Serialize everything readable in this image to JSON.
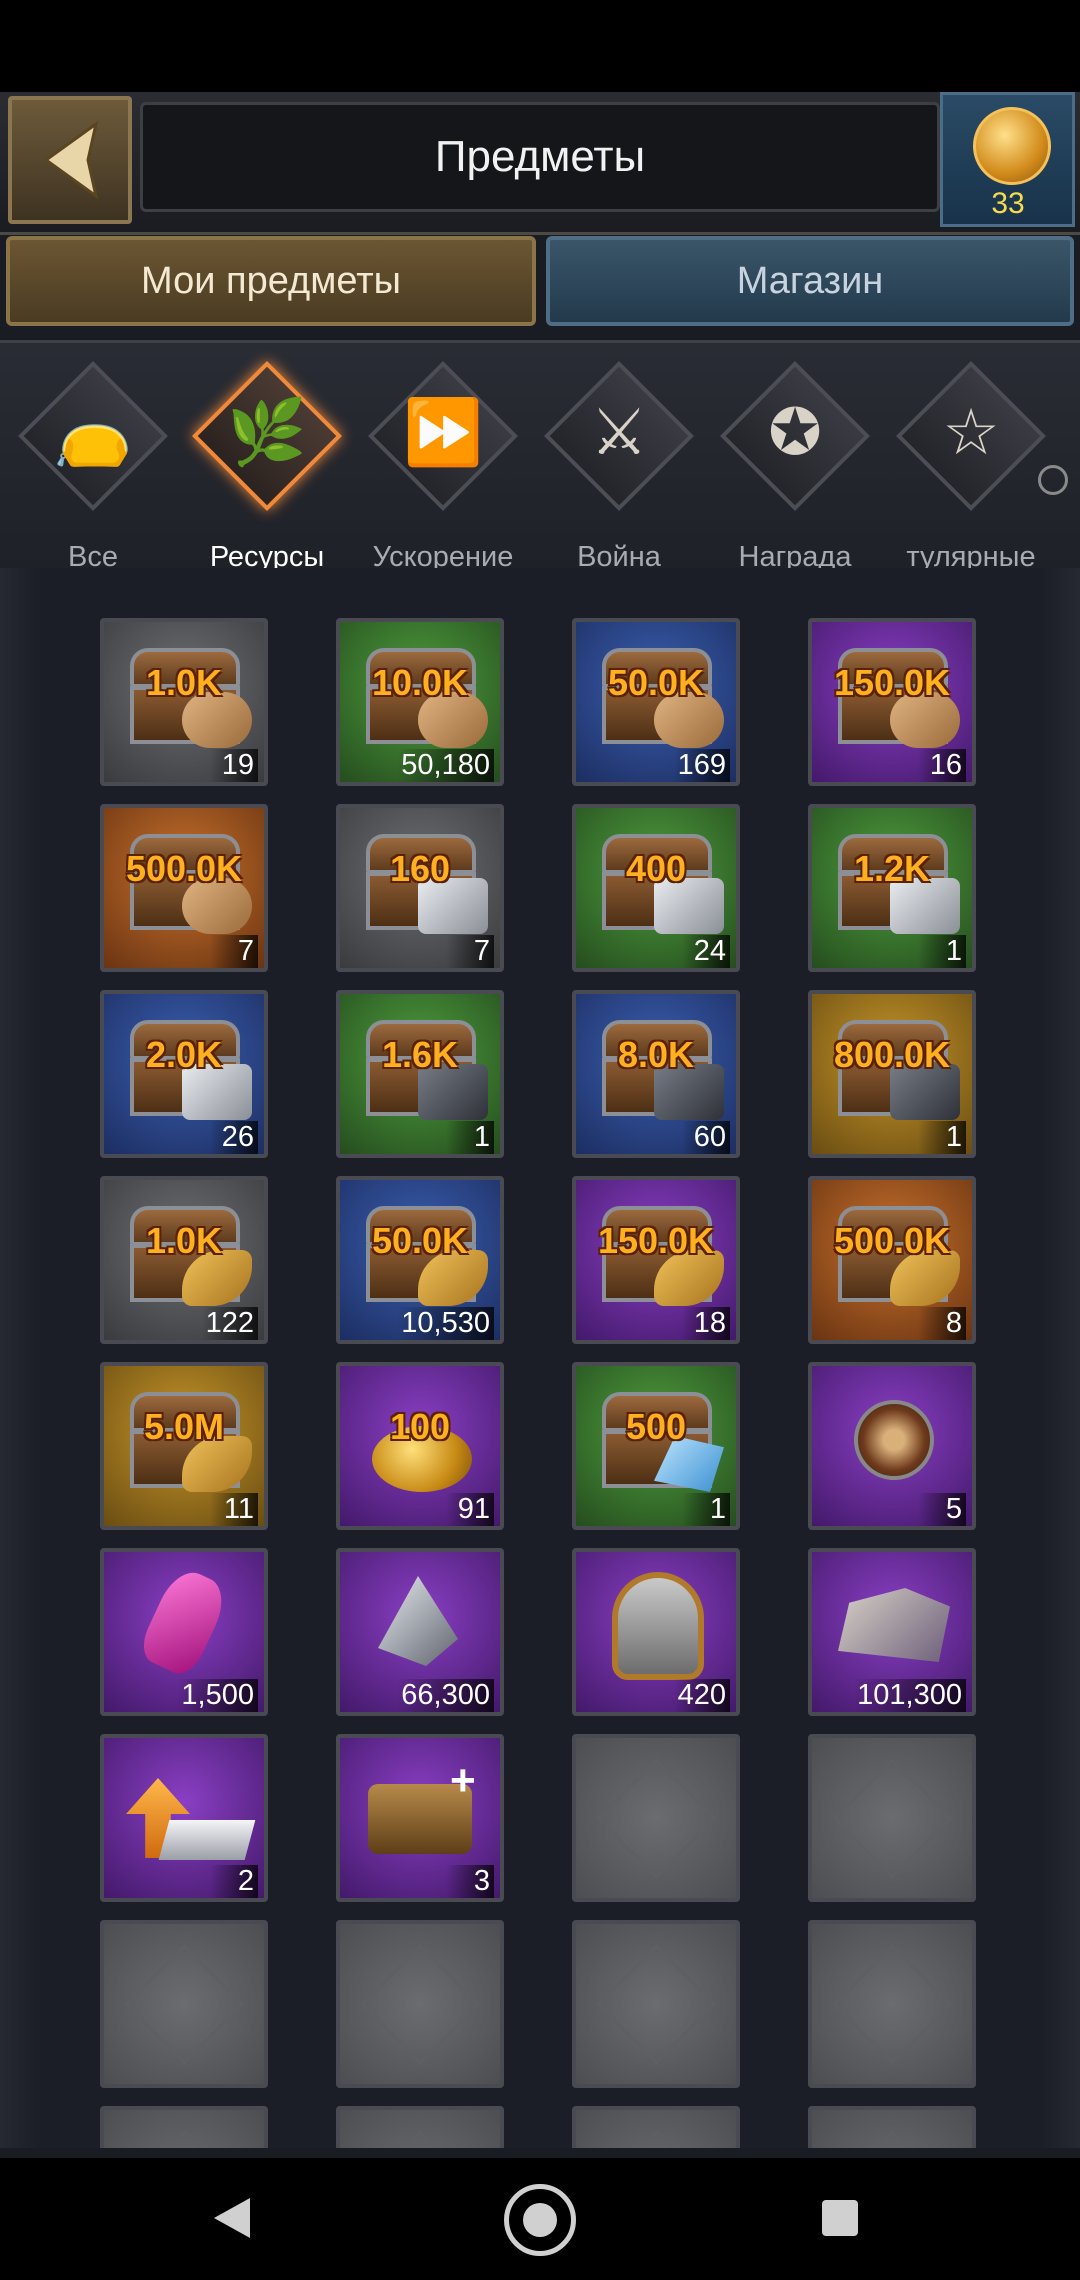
{
  "header": {
    "title": "Предметы",
    "coins": "33"
  },
  "tabs": {
    "my_items": "Мои предметы",
    "shop": "Магазин"
  },
  "categories": [
    {
      "label": "Все",
      "icon": "bag-icon",
      "glyph": "👝"
    },
    {
      "label": "Ресурсы",
      "icon": "plant-icon",
      "glyph": "🌿",
      "active": true
    },
    {
      "label": "Ускорение",
      "icon": "fast-forward-icon",
      "glyph": "⏩"
    },
    {
      "label": "Война",
      "icon": "crossed-swords-icon",
      "glyph": "⚔"
    },
    {
      "label": "Награда",
      "icon": "star-badge-icon",
      "glyph": "✪"
    },
    {
      "label": "тулярные",
      "icon": "star-icon",
      "glyph": "☆"
    }
  ],
  "items": [
    {
      "type": "chest",
      "res": "wood",
      "bg": "gray",
      "amount": "1.0K",
      "count": "19"
    },
    {
      "type": "chest",
      "res": "wood",
      "bg": "green",
      "amount": "10.0K",
      "count": "50,180"
    },
    {
      "type": "chest",
      "res": "wood",
      "bg": "blue",
      "amount": "50.0K",
      "count": "169"
    },
    {
      "type": "chest",
      "res": "wood",
      "bg": "purple",
      "amount": "150.0K",
      "count": "16"
    },
    {
      "type": "chest",
      "res": "wood",
      "bg": "orange",
      "amount": "500.0K",
      "count": "7"
    },
    {
      "type": "chest",
      "res": "iron",
      "bg": "gray",
      "amount": "160",
      "count": "7"
    },
    {
      "type": "chest",
      "res": "iron",
      "bg": "green",
      "amount": "400",
      "count": "24"
    },
    {
      "type": "chest",
      "res": "iron",
      "bg": "green",
      "amount": "1.2K",
      "count": "1"
    },
    {
      "type": "chest",
      "res": "iron",
      "bg": "blue",
      "amount": "2.0K",
      "count": "26"
    },
    {
      "type": "chest",
      "res": "ore",
      "bg": "green",
      "amount": "1.6K",
      "count": "1"
    },
    {
      "type": "chest",
      "res": "ore",
      "bg": "blue",
      "amount": "8.0K",
      "count": "60"
    },
    {
      "type": "chest",
      "res": "ore",
      "bg": "gold",
      "amount": "800.0K",
      "count": "1"
    },
    {
      "type": "chest",
      "res": "wheat",
      "bg": "gray",
      "amount": "1.0K",
      "count": "122"
    },
    {
      "type": "chest",
      "res": "wheat",
      "bg": "blue",
      "amount": "50.0K",
      "count": "10,530"
    },
    {
      "type": "chest",
      "res": "wheat",
      "bg": "purple",
      "amount": "150.0K",
      "count": "18"
    },
    {
      "type": "chest",
      "res": "wheat",
      "bg": "orange",
      "amount": "500.0K",
      "count": "8"
    },
    {
      "type": "chest",
      "res": "wheat",
      "bg": "gold",
      "amount": "5.0M",
      "count": "11"
    },
    {
      "type": "coins",
      "bg": "purple",
      "amount": "100",
      "count": "91"
    },
    {
      "type": "gemchest",
      "bg": "green",
      "amount": "500",
      "count": "1"
    },
    {
      "type": "emblem",
      "bg": "purple",
      "amount": "",
      "count": "5"
    },
    {
      "type": "gem",
      "bg": "purple",
      "amount": "",
      "count": "1,500"
    },
    {
      "type": "crystal",
      "bg": "purple",
      "amount": "",
      "count": "66,300"
    },
    {
      "type": "helmet",
      "bg": "purple",
      "amount": "",
      "count": "420"
    },
    {
      "type": "rock",
      "bg": "purple",
      "amount": "",
      "count": "101,300"
    },
    {
      "type": "upgrade",
      "bg": "purple",
      "amount": "",
      "count": "2"
    },
    {
      "type": "cart",
      "bg": "purple",
      "amount": "",
      "count": "3"
    },
    {
      "type": "empty"
    },
    {
      "type": "empty"
    },
    {
      "type": "empty"
    },
    {
      "type": "empty"
    },
    {
      "type": "empty"
    },
    {
      "type": "empty"
    },
    {
      "type": "empty"
    },
    {
      "type": "empty"
    },
    {
      "type": "empty"
    },
    {
      "type": "empty"
    }
  ]
}
